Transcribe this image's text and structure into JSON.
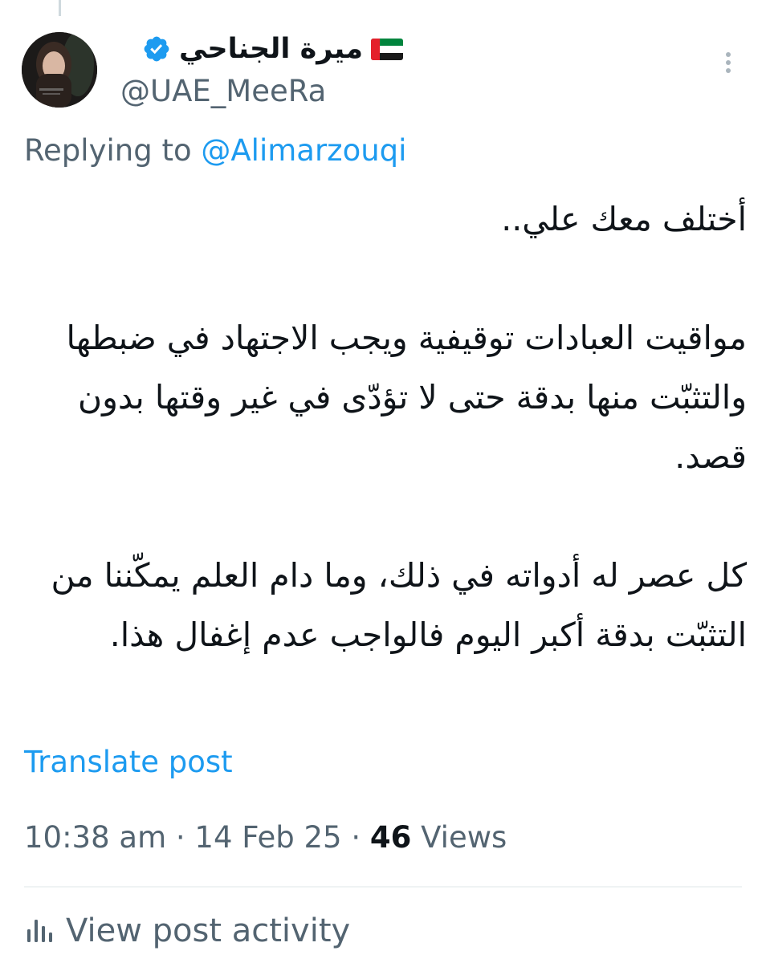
{
  "author": {
    "display_name": "ميرة الجناحي",
    "handle": "@UAE_MeeRa",
    "flag": "uae-flag-icon",
    "verified": true
  },
  "reply": {
    "prefix": "Replying to ",
    "handle": "@Alimarzouqi"
  },
  "post": {
    "paragraphs": [
      "أختلف معك علي..",
      "مواقيت العبادات توقيفية ويجب الاجتهاد في ضبطها والتثبّت منها بدقة حتى لا تؤدّى في غير وقتها بدون قصد.",
      "كل عصر له أدواته في ذلك، وما دام العلم يمكّننا من التثبّت بدقة أكبر اليوم فالواجب عدم إغفال هذا."
    ]
  },
  "translate_label": "Translate post",
  "meta": {
    "time": "10:38 am",
    "separator": " · ",
    "date": "14 Feb 25",
    "views_count": "46",
    "views_label": " Views"
  },
  "activity_label": "View post activity",
  "colors": {
    "link": "#1d9bf0",
    "secondary_text": "#536471",
    "primary_text": "#0f1419",
    "divider": "#eff3f4"
  }
}
